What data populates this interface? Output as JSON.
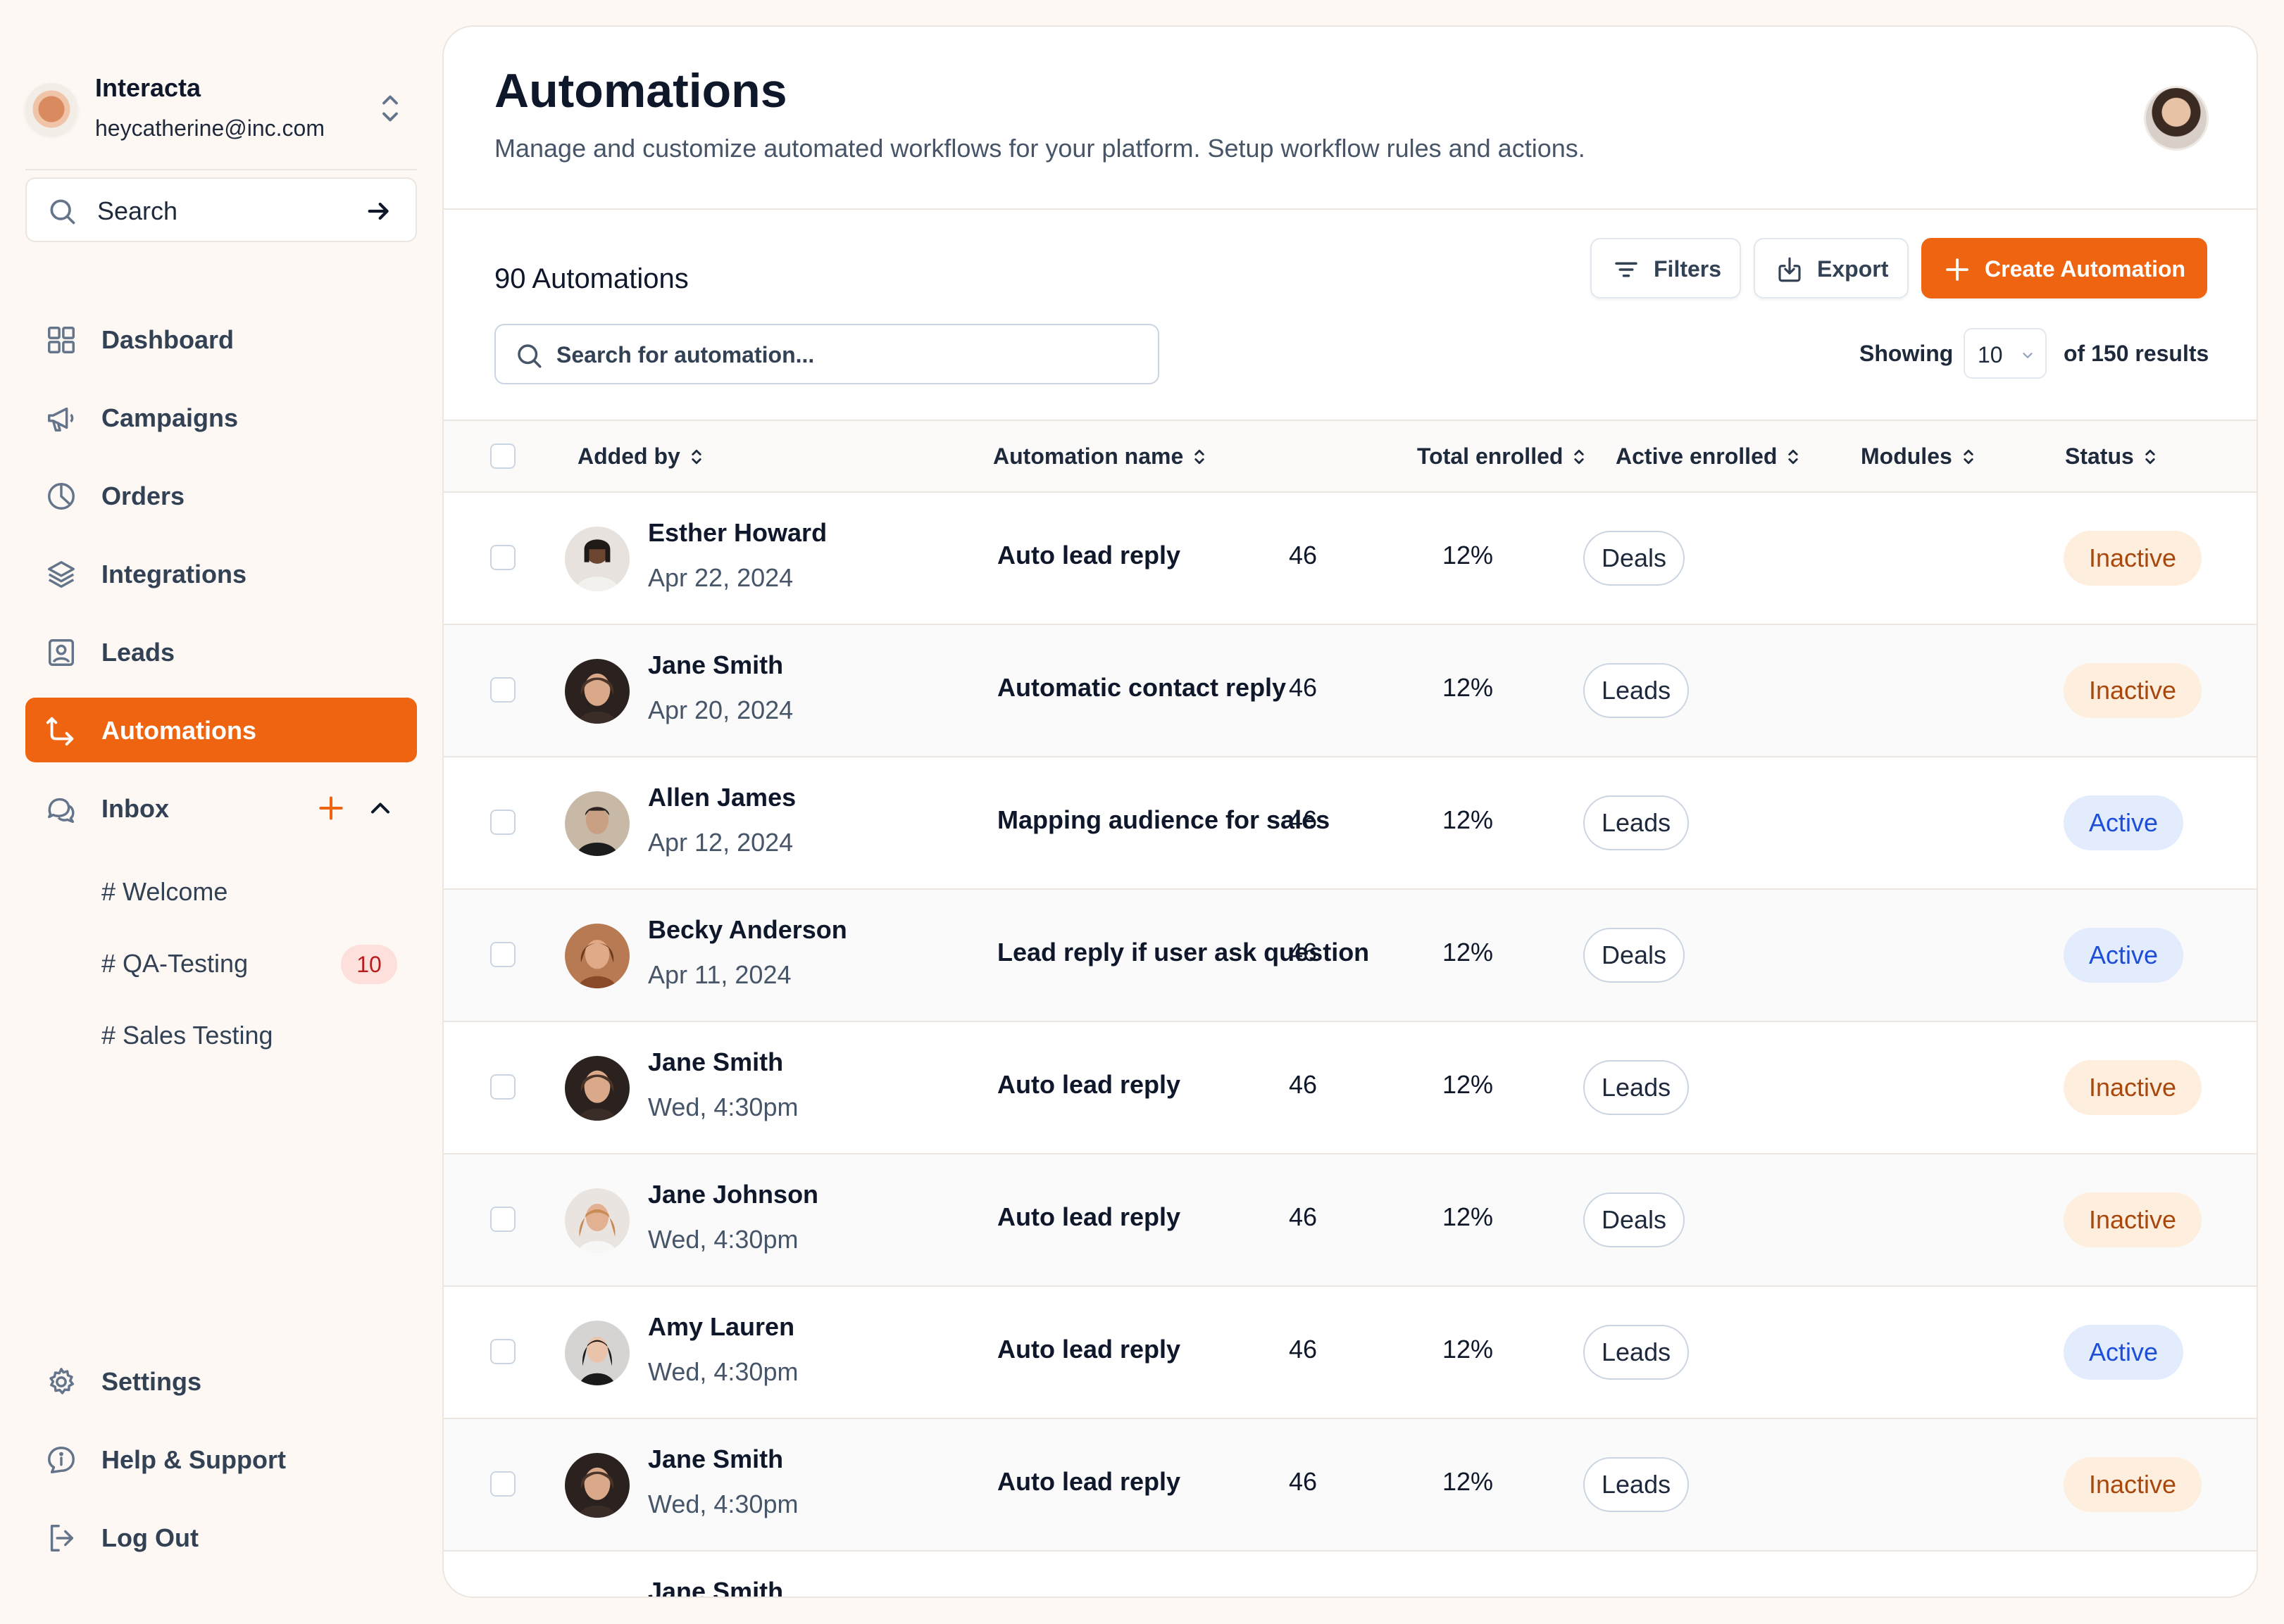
{
  "workspace": {
    "name": "Interacta",
    "email": "heycatherine@inc.com"
  },
  "sidebar": {
    "search_label": "Search",
    "items": [
      {
        "label": "Dashboard",
        "icon": "grid-icon"
      },
      {
        "label": "Campaigns",
        "icon": "megaphone-icon"
      },
      {
        "label": "Orders",
        "icon": "pie-chart-icon"
      },
      {
        "label": "Integrations",
        "icon": "layers-icon"
      },
      {
        "label": "Leads",
        "icon": "contact-icon"
      },
      {
        "label": "Automations",
        "icon": "route-icon",
        "active": true
      },
      {
        "label": "Inbox",
        "icon": "chat-icon"
      }
    ],
    "channels": [
      {
        "label": "# Welcome"
      },
      {
        "label": "# QA-Testing",
        "badge": "10"
      },
      {
        "label": "# Sales Testing"
      }
    ],
    "bottom": [
      {
        "label": "Settings",
        "icon": "gear-icon"
      },
      {
        "label": "Help & Support",
        "icon": "info-icon"
      },
      {
        "label": "Log Out",
        "icon": "logout-icon"
      }
    ]
  },
  "header": {
    "title": "Automations",
    "subtitle": "Manage and customize automated workflows for your platform. Setup workflow rules and actions."
  },
  "toolbar": {
    "count_label": "90 Automations",
    "filters_label": "Filters",
    "export_label": "Export",
    "create_label": "Create Automation",
    "search_placeholder": "Search for automation...",
    "showing_label": "Showing",
    "page_size": "10",
    "results_label": "of 150 results"
  },
  "table": {
    "columns": [
      "Added by",
      "Automation name",
      "Total enrolled",
      "Active enrolled",
      "Modules",
      "Status"
    ],
    "rows": [
      {
        "name": "Esther Howard",
        "date": "Apr 22, 2024",
        "automation": "Auto lead reply",
        "total": "46",
        "active": "12%",
        "module": "Deals",
        "status": "Inactive"
      },
      {
        "name": "Jane Smith",
        "date": "Apr 20, 2024",
        "automation": "Automatic contact reply",
        "total": "46",
        "active": "12%",
        "module": "Leads",
        "status": "Inactive"
      },
      {
        "name": "Allen James",
        "date": "Apr 12, 2024",
        "automation": "Mapping audience for sales",
        "total": "46",
        "active": "12%",
        "module": "Leads",
        "status": "Active"
      },
      {
        "name": "Becky Anderson",
        "date": "Apr 11, 2024",
        "automation": "Lead reply if user ask question",
        "total": "46",
        "active": "12%",
        "module": "Deals",
        "status": "Active"
      },
      {
        "name": "Jane Smith",
        "date": "Wed, 4:30pm",
        "automation": "Auto lead reply",
        "total": "46",
        "active": "12%",
        "module": "Leads",
        "status": "Inactive"
      },
      {
        "name": "Jane Johnson",
        "date": "Wed, 4:30pm",
        "automation": "Auto lead reply",
        "total": "46",
        "active": "12%",
        "module": "Deals",
        "status": "Inactive"
      },
      {
        "name": "Amy Lauren",
        "date": "Wed, 4:30pm",
        "automation": "Auto lead reply",
        "total": "46",
        "active": "12%",
        "module": "Leads",
        "status": "Active"
      },
      {
        "name": "Jane Smith",
        "date": "Wed, 4:30pm",
        "automation": "Auto lead reply",
        "total": "46",
        "active": "12%",
        "module": "Leads",
        "status": "Inactive"
      }
    ],
    "partial_row_name": "Jane Smith"
  },
  "colors": {
    "accent": "#ef6410",
    "inactive_bg": "#fdeede",
    "active_bg": "#e3ecfd"
  }
}
